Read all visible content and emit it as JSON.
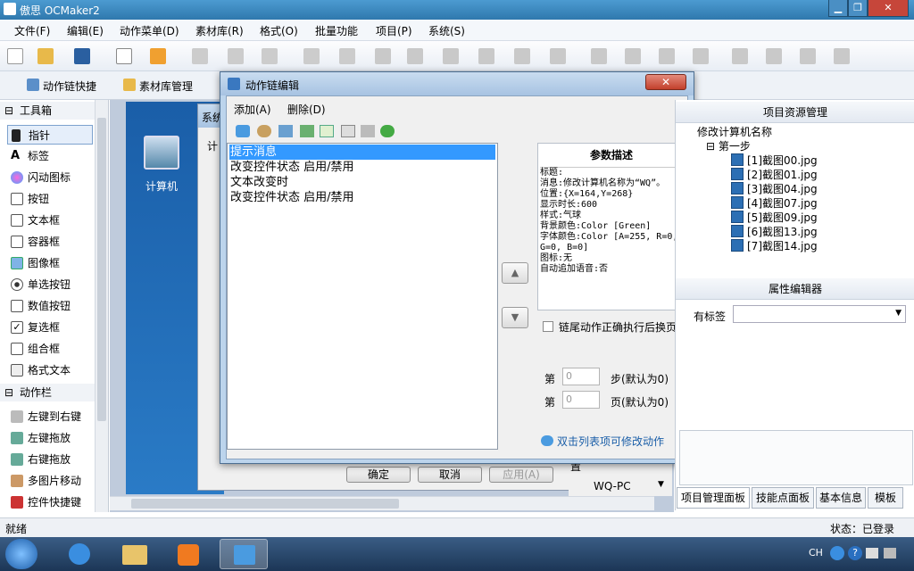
{
  "window": {
    "title": "傲思 OCMaker2"
  },
  "menu": [
    "文件(F)",
    "编辑(E)",
    "动作菜单(D)",
    "素材库(R)",
    "格式(O)",
    "批量功能",
    "项目(P)",
    "系统(S)"
  ],
  "toolbar2": {
    "action_shortcut": "动作链快捷",
    "asset_mgmt": "素材库管理"
  },
  "toolbox": {
    "group_tools": "工具箱",
    "tools": [
      "指针",
      "标签",
      "闪动图标",
      "按钮",
      "文本框",
      "容器框",
      "图像框",
      "单选按钮",
      "数值按钮",
      "复选框",
      "组合框",
      "格式文本"
    ],
    "group_actions": "动作栏",
    "actions": [
      "左键到右键",
      "左键拖放",
      "右键拖放",
      "多图片移动",
      "控件快捷键"
    ]
  },
  "canvas": {
    "desktop_icon_label": "计算机",
    "bg_window_title": "系统",
    "bg_tab_label": "计",
    "bg_ok": "确定",
    "bg_cancel": "取消",
    "bg_apply": "应用(A)",
    "computer_name": "WQ-PC",
    "partial_field": "置"
  },
  "dialog": {
    "title": "动作链编辑",
    "menu_add": "添加(A)",
    "menu_delete": "删除(D)",
    "close_symbol": "✕",
    "list_items": [
      "提示消息",
      "改变控件状态 启用/禁用",
      "文本改变时",
      "改变控件状态 启用/禁用"
    ],
    "selected_index": 0,
    "param_title": "参数描述",
    "param_text": "标题:\n消息:修改计算机名称为“WQ”。\n位置:{X=164,Y=268}\n显示时长:600\n样式:气球\n背景颜色:Color [Green]\n字体颜色:Color [A=255, R=0, G=0, B=0]\n图标:无\n自动追加语音:否",
    "checkbox_label": "链尾动作正确执行后换页",
    "step_prefix": "第",
    "step_value": "0",
    "step_suffix": "步(默认为0)",
    "page_prefix": "第",
    "page_value": "0",
    "page_suffix": "页(默认为0)",
    "hint": "双击列表项可修改动作"
  },
  "right_panel": {
    "project_title": "项目资源管理",
    "root": "修改计算机名称",
    "step": "第一步",
    "images": [
      "[1]截图00.jpg",
      "[2]截图01.jpg",
      "[3]截图04.jpg",
      "[4]截图07.jpg",
      "[5]截图09.jpg",
      "[6]截图13.jpg",
      "[7]截图14.jpg"
    ],
    "property_title": "属性编辑器",
    "tag_label": "有标签",
    "tabs": [
      "项目管理面板",
      "技能点面板",
      "基本信息",
      "模板"
    ]
  },
  "status": {
    "left": "就绪",
    "right": "状态：已登录"
  },
  "taskbar": {
    "lang": "CH"
  },
  "colors": {
    "selection": "#3399ff",
    "titlebar": "#2f78ad",
    "taskbar": "#1c3656"
  }
}
